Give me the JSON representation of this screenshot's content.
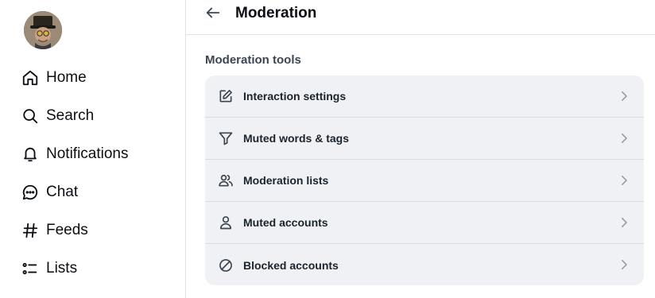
{
  "sidebar": {
    "avatar_alt": "profile avatar",
    "items": [
      {
        "label": "Home",
        "icon": "home-icon"
      },
      {
        "label": "Search",
        "icon": "search-icon"
      },
      {
        "label": "Notifications",
        "icon": "bell-icon"
      },
      {
        "label": "Chat",
        "icon": "chat-icon"
      },
      {
        "label": "Feeds",
        "icon": "hash-icon"
      },
      {
        "label": "Lists",
        "icon": "list-icon"
      }
    ]
  },
  "header": {
    "title": "Moderation",
    "back_icon": "arrow-left-icon"
  },
  "section": {
    "title": "Moderation tools",
    "items": [
      {
        "label": "Interaction settings",
        "icon": "edit-icon"
      },
      {
        "label": "Muted words & tags",
        "icon": "filter-icon"
      },
      {
        "label": "Moderation lists",
        "icon": "users-icon"
      },
      {
        "label": "Muted accounts",
        "icon": "person-icon"
      },
      {
        "label": "Blocked accounts",
        "icon": "block-icon"
      }
    ]
  },
  "colors": {
    "text": "#0b0f14",
    "card_bg": "#eff1f4",
    "divider": "#dfe3e7",
    "muted": "#3c4652",
    "chevron": "#8a96a3"
  }
}
